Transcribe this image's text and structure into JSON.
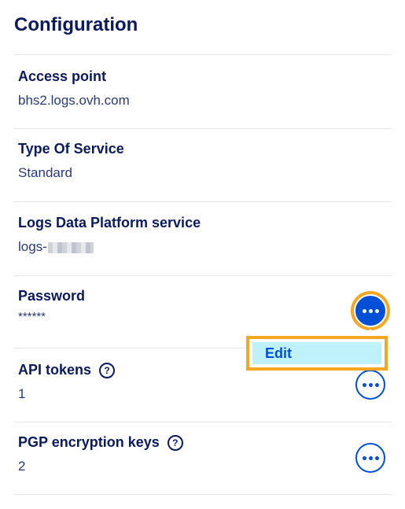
{
  "section": {
    "title": "Configuration"
  },
  "rows": [
    {
      "label": "Access point",
      "value": "bhs2.logs.ovh.com"
    },
    {
      "label": "Type Of Service",
      "value": "Standard"
    },
    {
      "label": "Logs Data Platform service",
      "value": "logs-"
    },
    {
      "label": "Password",
      "value": "******"
    },
    {
      "label": "API tokens",
      "value": "1",
      "help_icon": "question-circle-icon"
    },
    {
      "label": "PGP encryption keys",
      "value": "2",
      "help_icon": "question-circle-icon"
    }
  ],
  "action_menu": {
    "items": [
      "Edit"
    ]
  },
  "icons": {
    "more": "ellipsis-icon",
    "help": "question-circle-icon"
  },
  "colors": {
    "primary": "#0050d7",
    "title": "#0a1a5c",
    "highlight": "#f5a623",
    "menu_bg": "#bff1fb"
  }
}
